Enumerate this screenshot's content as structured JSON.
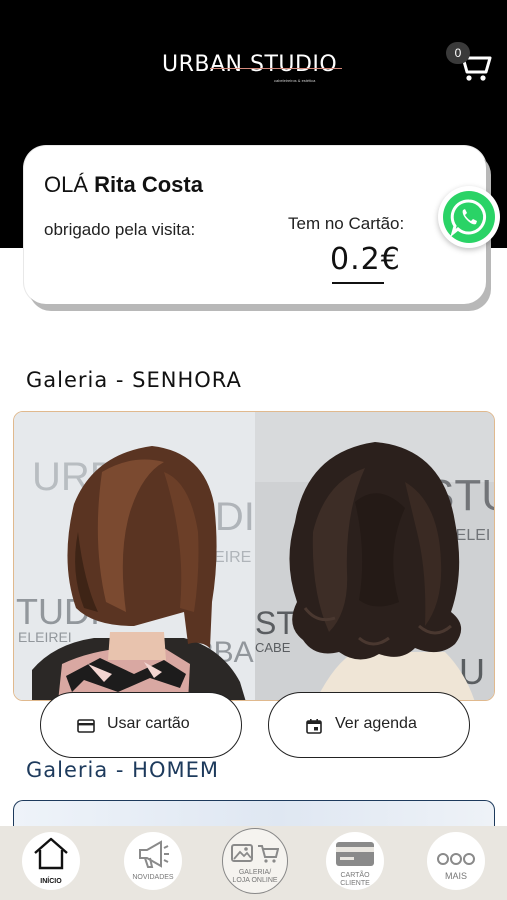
{
  "header": {
    "logo_text": "URBAN STUDIO",
    "logo_subtitle": "cabeleireiros & estética",
    "cart_count": "0"
  },
  "greeting": {
    "hello": "OLÁ",
    "name": "Rita Costa",
    "thanks": "obrigado pela visita:",
    "card_label": "Tem no Cartão:",
    "card_balance": "0.2€"
  },
  "sections": {
    "senhora_title": "Galeria - SENHORA",
    "homem_title": "Galeria - HOMEM"
  },
  "buttons": {
    "usar_cartao": "Usar cartão",
    "ver_agenda": "Ver agenda"
  },
  "photo_wall_text": {
    "left_top": "URB",
    "left_mid": "UDI",
    "left_sub": "EIRE",
    "left_bottom": "TUDIO",
    "left_bottom_sub": "ELEIREI",
    "left_right": "RBA",
    "right_top": "STU",
    "right_sub": "BELEI",
    "right_bottom": "STU",
    "right_bottom_sub": "CABE",
    "right_corner": "U"
  },
  "nav": {
    "inicio": "INÍCIO",
    "novidades": "NOVIDADES",
    "galeria_l1": "GALERIA/",
    "galeria_l2": "LOJA ONLINE",
    "cartao_l1": "CARTÃO",
    "cartao_l2": "CLIENTE",
    "mais": "MAIS"
  },
  "colors": {
    "header_bg": "#000000",
    "whatsapp": "#2ad366",
    "homem_title": "#1d3a5c",
    "gallery_border": "#e0b98e",
    "nav_bg": "#e9e6e0"
  }
}
